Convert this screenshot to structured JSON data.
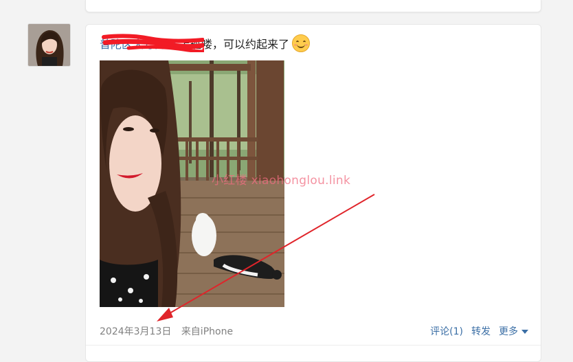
{
  "post": {
    "username": "普陀区大号门潜",
    "text": "上班喽，可以约起来了",
    "emoji": "smile-emoji",
    "watermark": "小红楼 xiaohonglou.link",
    "date": "2024年3月13日",
    "source": "来自iPhone",
    "actions": {
      "comment": "评论(1)",
      "repost": "转发",
      "more": "更多"
    }
  },
  "colors": {
    "link": "#3a6ea5",
    "redaction": "#f21b25",
    "arrow": "#e0242a",
    "watermark": "#f06e82"
  }
}
